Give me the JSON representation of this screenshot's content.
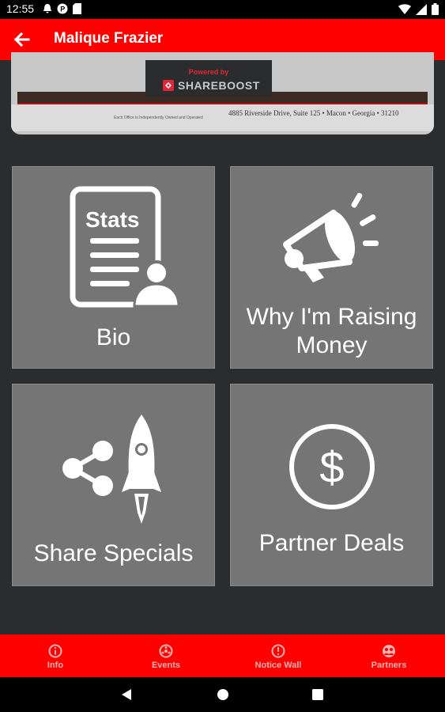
{
  "status_bar": {
    "time": "12:55",
    "left_icons": [
      "notification-bell-icon",
      "app-p-icon",
      "sd-card-icon"
    ],
    "right_icons": [
      "wifi-icon",
      "signal-icon",
      "battery-icon"
    ]
  },
  "app_bar": {
    "title": "Malique Frazier",
    "back_icon": "back-arrow-icon",
    "background": "#ff0000"
  },
  "banner": {
    "powered_by": "Powered by",
    "brand": "SHAREBOOST",
    "small_note": "Each Office is Independently Owned and Operated",
    "address": "4885 Riverside Drive, Suite 125 • Macon • Georgia • 31210"
  },
  "tiles": [
    {
      "label": "Bio",
      "icon": "stats-document-person-icon",
      "icon_text": "Stats"
    },
    {
      "label_line1": "Why I'm Raising",
      "label_line2": "Money",
      "icon": "megaphone-icon"
    },
    {
      "label": "Share Specials",
      "icon": "share-rocket-icon"
    },
    {
      "label": "Partner Deals",
      "icon": "dollar-circle-icon"
    }
  ],
  "bottom_nav": {
    "items": [
      {
        "label": "Info",
        "icon": "info-icon"
      },
      {
        "label": "Events",
        "icon": "events-icon"
      },
      {
        "label": "Notice Wall",
        "icon": "notice-icon"
      },
      {
        "label": "Partners",
        "icon": "partners-icon"
      }
    ]
  },
  "system_nav": {
    "icons": [
      "back-triangle-icon",
      "home-circle-icon",
      "recents-square-icon"
    ]
  }
}
